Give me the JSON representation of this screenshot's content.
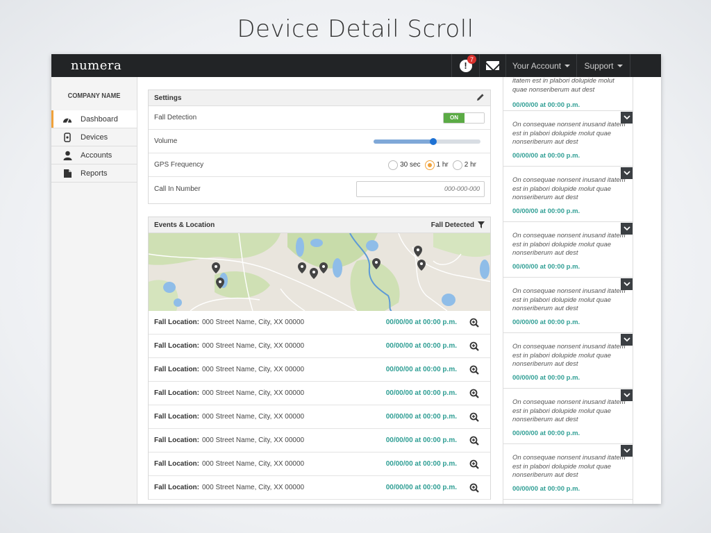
{
  "slide_title": "Device Detail Scroll",
  "topbar": {
    "logo": "numera",
    "alert_count": "7",
    "account_label": "Your Account",
    "support_label": "Support"
  },
  "sidebar": {
    "company": "COMPANY NAME",
    "items": [
      {
        "label": "Dashboard",
        "icon": "dashboard-icon",
        "active": true
      },
      {
        "label": "Devices",
        "icon": "device-icon",
        "active": false
      },
      {
        "label": "Accounts",
        "icon": "person-icon",
        "active": false
      },
      {
        "label": "Reports",
        "icon": "report-icon",
        "active": false
      }
    ]
  },
  "settings": {
    "title": "Settings",
    "fall_detection": {
      "label": "Fall Detection",
      "state": "ON"
    },
    "volume": {
      "label": "Volume",
      "level": 0.56
    },
    "gps": {
      "label": "GPS Frequency",
      "options": [
        "30 sec",
        "1 hr",
        "2 hr"
      ],
      "selected": "1 hr"
    },
    "call_in": {
      "label": "Call In Number",
      "placeholder": "000-000-000"
    }
  },
  "events": {
    "title": "Events & Location",
    "filter_label": "Fall Detected",
    "rows": [
      {
        "label": "Fall Location:",
        "address": "000 Street Name, City, XX 00000",
        "datetime": "00/00/00 at 00:00 p.m."
      },
      {
        "label": "Fall Location:",
        "address": "000 Street Name, City, XX 00000",
        "datetime": "00/00/00 at 00:00 p.m."
      },
      {
        "label": "Fall Location:",
        "address": "000 Street Name, City, XX 00000",
        "datetime": "00/00/00 at 00:00 p.m."
      },
      {
        "label": "Fall Location:",
        "address": "000 Street Name, City, XX 00000",
        "datetime": "00/00/00 at 00:00 p.m."
      },
      {
        "label": "Fall Location:",
        "address": "000 Street Name, City, XX 00000",
        "datetime": "00/00/00 at 00:00 p.m."
      },
      {
        "label": "Fall Location:",
        "address": "000 Street Name, City, XX 00000",
        "datetime": "00/00/00 at 00:00 p.m."
      },
      {
        "label": "Fall Location:",
        "address": "000 Street Name, City, XX 00000",
        "datetime": "00/00/00 at 00:00 p.m."
      },
      {
        "label": "Fall Location:",
        "address": "000 Street Name, City, XX 00000",
        "datetime": "00/00/00 at 00:00 p.m."
      }
    ]
  },
  "notes": {
    "partial_text": "itatem est in plabori dolupide molut quae nonseriberum aut dest",
    "partial_date": "00/00/00 at 00:00 p.m.",
    "items": [
      {
        "text": "On consequae nonsent inusand itatem est in plabori dolupide molut quae nonseriberum aut dest",
        "date": "00/00/00 at 00:00 p.m."
      },
      {
        "text": "On consequae nonsent inusand itatem est in plabori dolupide molut quae nonseriberum aut dest",
        "date": "00/00/00 at 00:00 p.m."
      },
      {
        "text": "On consequae nonsent inusand itatem est in plabori dolupide molut quae nonseriberum aut dest",
        "date": "00/00/00 at 00:00 p.m."
      },
      {
        "text": "On consequae nonsent inusand itatem est in plabori dolupide molut quae nonseriberum aut dest",
        "date": "00/00/00 at 00:00 p.m."
      },
      {
        "text": "On consequae nonsent inusand itatem est in plabori dolupide molut quae nonseriberum aut dest",
        "date": "00/00/00 at 00:00 p.m."
      },
      {
        "text": "On consequae nonsent inusand itatem est in plabori dolupide molut quae nonseriberum aut dest",
        "date": "00/00/00 at 00:00 p.m."
      },
      {
        "text": "On consequae nonsent inusand itatem est in plabori dolupide molut quae nonseriberum aut dest",
        "date": "00/00/00 at 00:00 p.m."
      }
    ]
  },
  "colors": {
    "accent": "#f0a23b",
    "teal": "#2f9e94",
    "toggle_on": "#5bab45",
    "topbar": "#222426"
  }
}
